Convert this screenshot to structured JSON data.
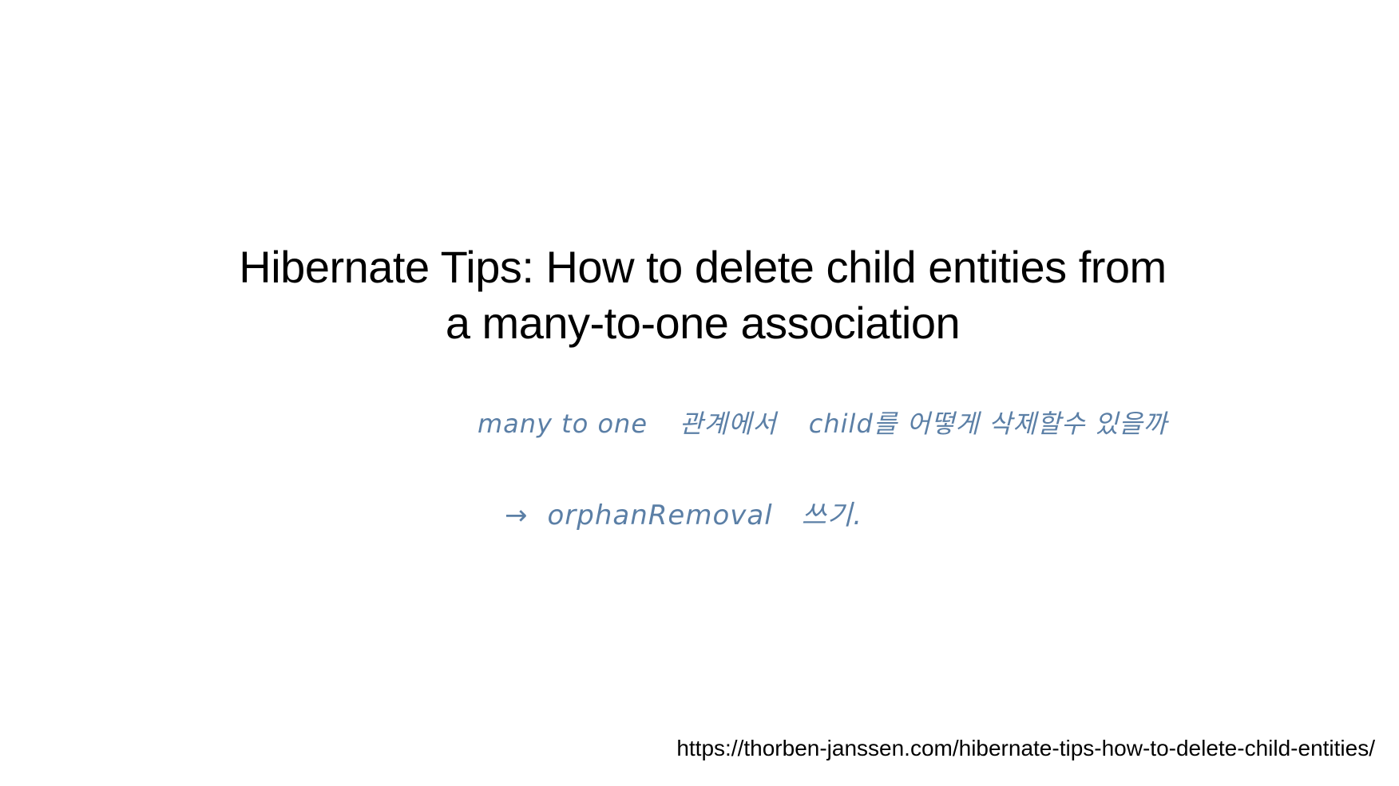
{
  "slide": {
    "title_line_1": "Hibernate Tips: How to delete child entities from",
    "title_line_2": "a many-to-one association",
    "note_1": {
      "part_a": "many to one",
      "part_b": "관계에서",
      "part_c": "child를 어떻게 삭제할수 있을까"
    },
    "note_2": {
      "arrow": "→",
      "part_a": "orphanRemoval",
      "part_b": "쓰기."
    },
    "source_url": "https://thorben-janssen.com/hibernate-tips-how-to-delete-child-entities/"
  },
  "colors": {
    "background": "#ffffff",
    "title_text": "#000000",
    "handwriting_ink": "#5b7fa6"
  }
}
